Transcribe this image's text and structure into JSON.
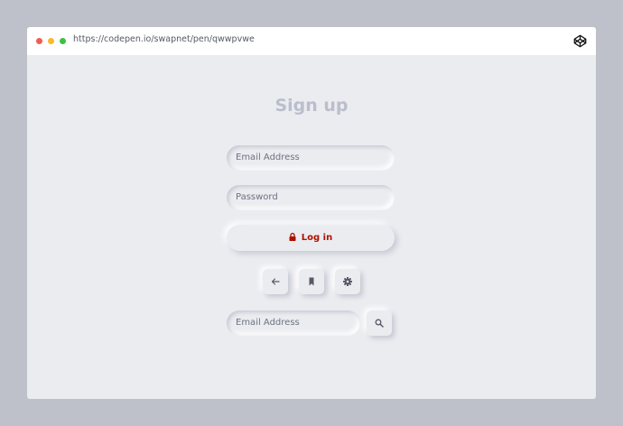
{
  "browser": {
    "url": "https://codepen.io/swapnet/pen/qwwpvwe",
    "logo_icon": "codepen-icon"
  },
  "form": {
    "title": "Sign up",
    "email_placeholder": "Email Address",
    "password_placeholder": "Password",
    "login_label": "Log in",
    "login_color": "#ae1100",
    "search_placeholder": "Email Address"
  },
  "icon_buttons": [
    {
      "icon": "arrow-left-icon"
    },
    {
      "icon": "bookmark-icon"
    },
    {
      "icon": "gear-icon"
    }
  ],
  "search_button": {
    "icon": "search-icon"
  },
  "colors": {
    "background": "#bec1c9",
    "panel": "#ebecf0",
    "title": "#babecc"
  }
}
